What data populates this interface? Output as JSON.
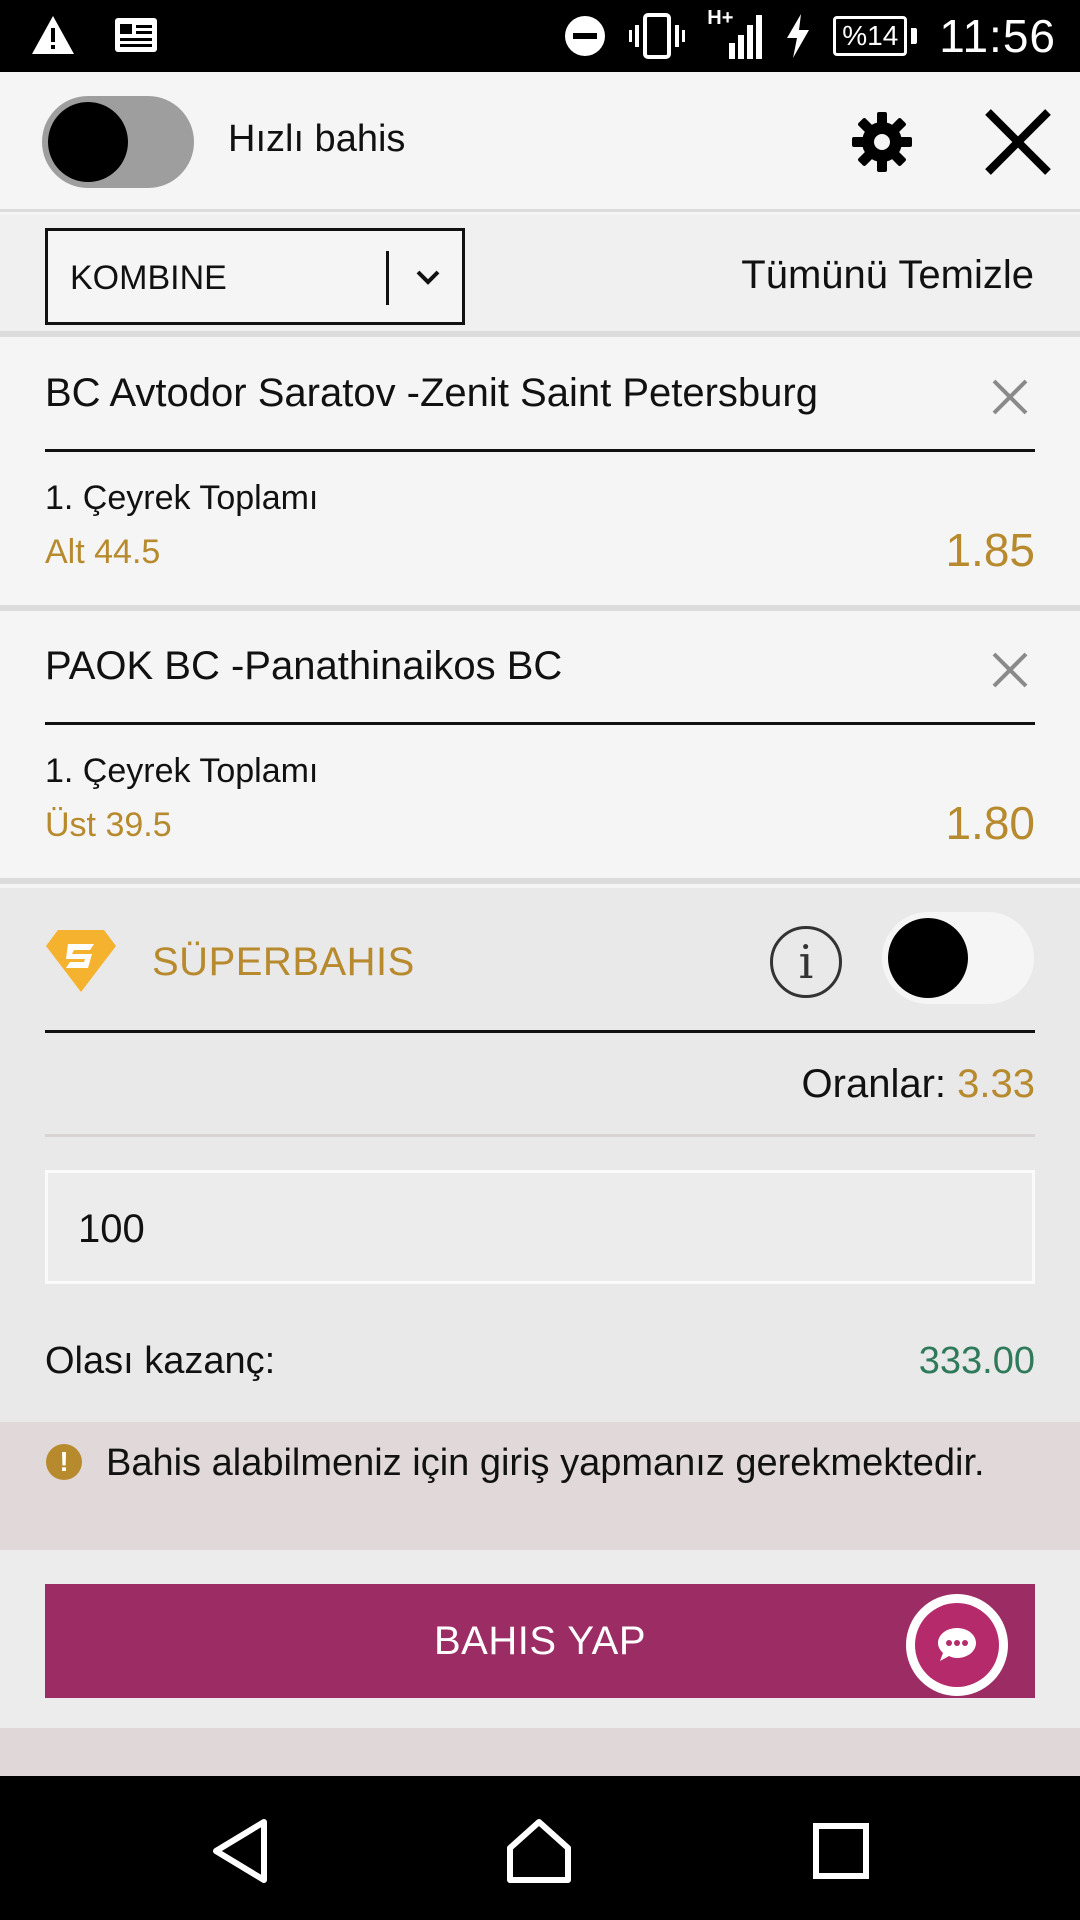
{
  "status_bar": {
    "left_icons": [
      "warning-icon",
      "news-icon"
    ],
    "right_icons": [
      "do-not-disturb-icon",
      "vibrate-icon",
      "signal-h-plus-icon",
      "charging-icon"
    ],
    "network_type": "H+",
    "battery_text": "%14",
    "time": "11:56"
  },
  "header": {
    "quick_bet_label": "Hızlı bahis",
    "quick_bet_on": false
  },
  "bet_type": {
    "selected": "KOMBINE",
    "clear_all_label": "Tümünü Temizle"
  },
  "bets": [
    {
      "match": "BC Avtodor Saratov -Zenit Saint Petersburg",
      "market": "1. Çeyrek Toplamı",
      "selection": "Alt 44.5",
      "odd": "1.85"
    },
    {
      "match": "PAOK BC -Panathinaikos BC",
      "market": "1. Çeyrek Toplamı",
      "selection": "Üst 39.5",
      "odd": "1.80"
    }
  ],
  "super_bet": {
    "label": "SÜPERBAHIS",
    "enabled": false,
    "odds_label": "Oranlar: ",
    "odds_value": "3.33",
    "stake": "100",
    "potential_win_label": "Olası kazanç:",
    "potential_win_value": "333.00"
  },
  "warning": {
    "text": "Bahis alabilmeniz için giriş yapmanız gerekmektedir."
  },
  "action": {
    "place_bet_label": "BAHIS YAP"
  },
  "colors": {
    "accent_gold": "#b88a2e",
    "button_magenta": "#9c2c64",
    "win_green": "#2f7a5a"
  }
}
